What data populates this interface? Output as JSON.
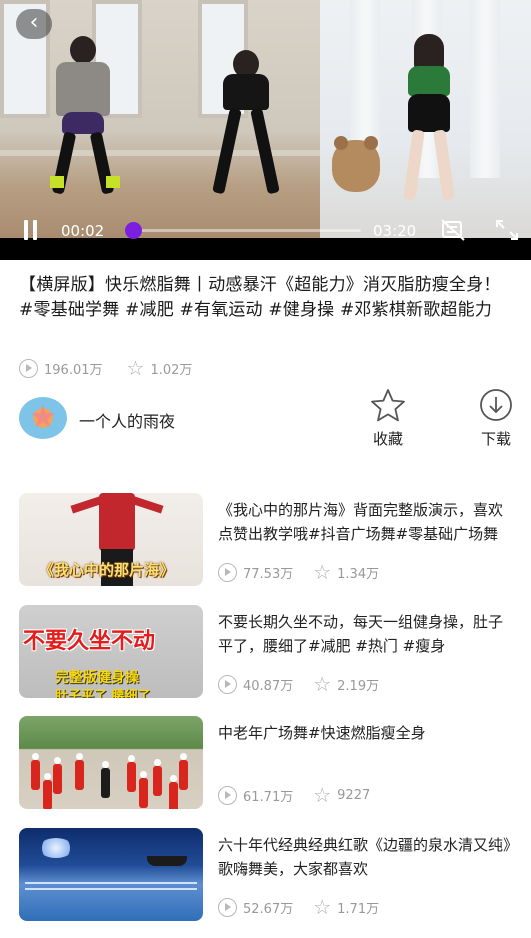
{
  "player": {
    "current_time": "00:02",
    "duration": "03:20",
    "progress_percent": 1,
    "back_label": "‹"
  },
  "video": {
    "title": "【横屏版】快乐燃脂舞丨动感暴汗《超能力》消灭脂肪瘦全身！ #零基础学舞 #减肥 #有氧运动 #健身操 #邓紫棋新歌超能力",
    "views": "196.01万",
    "likes": "1.02万"
  },
  "author": {
    "name": "一个人的雨夜"
  },
  "actions": {
    "collect_label": "收藏",
    "download_label": "下载"
  },
  "list": [
    {
      "title": "《我心中的那片海》背面完整版演示，喜欢点赞出教学哦#抖音广场舞#零基础广场舞",
      "views": "77.53万",
      "likes": "1.34万",
      "thumb_caption": "《我心中的那片海》"
    },
    {
      "title": "不要长期久坐不动，每天一组健身操，肚子平了，腰细了#减肥 #热门 #瘦身",
      "views": "40.87万",
      "likes": "2.19万",
      "thumb_caption": "不要久坐不动",
      "thumb_sub": "完整版健身操",
      "thumb_sub2": "肚子平了 腰细了"
    },
    {
      "title": "中老年广场舞#快速燃脂瘦全身",
      "views": "61.71万",
      "likes": "9227"
    },
    {
      "title": "六十年代经典经典红歌《边疆的泉水清又纯》歌嗨舞美，大家都喜欢",
      "views": "52.67万",
      "likes": "1.71万"
    }
  ]
}
